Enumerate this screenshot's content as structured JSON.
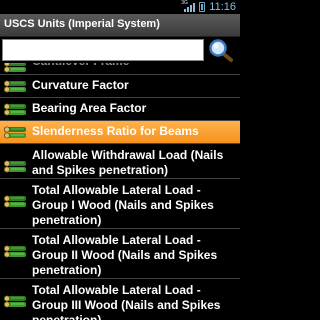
{
  "status": {
    "time": "11:16",
    "network": "3G"
  },
  "title": "USCS Units (Imperial System)",
  "search": {
    "value": ""
  },
  "items": [
    {
      "label": "Cantilever Frame",
      "type": "partial",
      "selected": false
    },
    {
      "label": "Curvature Factor",
      "type": "single",
      "selected": false
    },
    {
      "label": "Bearing Area Factor",
      "type": "single",
      "selected": false
    },
    {
      "label": "Slenderness Ratio for Beams",
      "type": "single",
      "selected": true
    },
    {
      "label": "Allowable Withdrawal Load (Nails and Spikes penetration)",
      "type": "multi",
      "selected": false
    },
    {
      "label": "Total Allowable Lateral Load - Group I Wood (Nails and Spikes penetration)",
      "type": "multi",
      "selected": false
    },
    {
      "label": "Total Allowable Lateral Load - Group II Wood (Nails and Spikes penetration)",
      "type": "multi",
      "selected": false
    },
    {
      "label": "Total Allowable Lateral Load - Group III Wood (Nails and Spikes penetration)",
      "type": "multi",
      "selected": false
    }
  ],
  "colors": {
    "accent": "#f6921e",
    "icon_green": "#3a9a2a"
  }
}
